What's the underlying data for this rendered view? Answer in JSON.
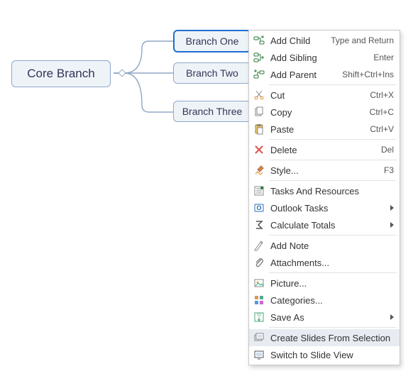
{
  "mindmap": {
    "core": "Core Branch",
    "branches": [
      "Branch One",
      "Branch Two",
      "Branch Three"
    ]
  },
  "menu": {
    "groups": [
      [
        {
          "icon": "add-child",
          "label": "Add Child",
          "shortcut": "Type and Return"
        },
        {
          "icon": "add-sibling",
          "label": "Add Sibling",
          "shortcut": "Enter"
        },
        {
          "icon": "add-parent",
          "label": "Add Parent",
          "shortcut": "Shift+Ctrl+Ins"
        }
      ],
      [
        {
          "icon": "cut",
          "label": "Cut",
          "shortcut": "Ctrl+X"
        },
        {
          "icon": "copy",
          "label": "Copy",
          "shortcut": "Ctrl+C"
        },
        {
          "icon": "paste",
          "label": "Paste",
          "shortcut": "Ctrl+V"
        }
      ],
      [
        {
          "icon": "delete",
          "label": "Delete",
          "shortcut": "Del"
        }
      ],
      [
        {
          "icon": "style",
          "label": "Style...",
          "shortcut": "F3"
        }
      ],
      [
        {
          "icon": "tasks",
          "label": "Tasks And Resources"
        },
        {
          "icon": "outlook",
          "label": "Outlook Tasks",
          "submenu": true
        },
        {
          "icon": "sigma",
          "label": "Calculate Totals",
          "submenu": true
        }
      ],
      [
        {
          "icon": "note",
          "label": "Add Note"
        },
        {
          "icon": "attach",
          "label": "Attachments..."
        }
      ],
      [
        {
          "icon": "picture",
          "label": "Picture..."
        },
        {
          "icon": "categories",
          "label": "Categories..."
        },
        {
          "icon": "saveas",
          "label": "Save As",
          "submenu": true
        }
      ],
      [
        {
          "icon": "slides",
          "label": "Create Slides From Selection",
          "highlight": true
        },
        {
          "icon": "slideview",
          "label": "Switch to Slide View"
        }
      ]
    ]
  }
}
